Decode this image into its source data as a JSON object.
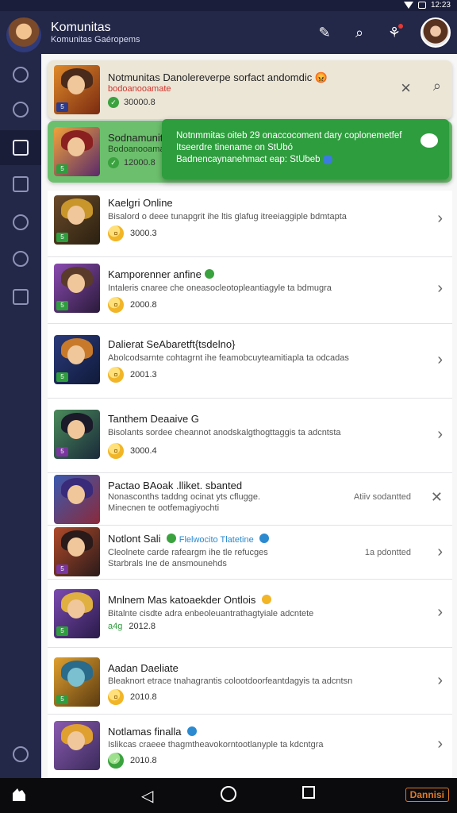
{
  "status_bar": {
    "time": "12:23"
  },
  "header": {
    "title": "Komunitas",
    "subtitle": "Komunitas Gaéropems"
  },
  "banners": [
    {
      "title": "Notmunitas Danolereverpe sorfact andomdic 😡",
      "sub": "bodoanooamate",
      "meta": "30000.8"
    },
    {
      "title": "Sodnamunitas",
      "sub": "Bodoanooamate",
      "meta": "12000.8"
    }
  ],
  "toast": {
    "line1": "Notnmmitas oiteb 29 onaccocoment dary coplonemetfef",
    "line2": "Itseerdre tinename on StUbó",
    "line3": "Badnencaynanehmact eap: StUbeb"
  },
  "rows": [
    {
      "title": "Kaelgri Online",
      "desc": "Bisalord o deee tunapgrit ihe ltis glafug itreeiaggiple bdmtapta",
      "meta": "3000.3"
    },
    {
      "title": "Kamporenner anfine",
      "desc": "Intaleris cnaree che oneasocleotopleantiagyle ta bdmugra",
      "meta": "2000.8"
    },
    {
      "title": "Dalierat SeAbaretft{tsdelno}",
      "desc": "Abolcodsarnte cohtagrnt ihe feamobcuyteamitiapla ta odcadas",
      "meta": "2001.3"
    },
    {
      "title": "Tanthem Deaaive G",
      "desc": "Bisolants sordee cheannot anodskalgthogttaggis ta adcntsta",
      "meta": "3000.4"
    },
    {
      "title": "Pactao BAoak .lliket. sbanted",
      "desc": "Nonasconths taddng ocinat yts cflugge.",
      "desc2": "Minecnen te ootfemagiyochti",
      "note": "Atiiv sodantted"
    },
    {
      "title": "Notlont Sali",
      "badge": "Flelwocito Tlatetine",
      "desc": "Cleolnete carde rafeargm ihe tle refucges",
      "desc2": "Starbrals Ine de ansmounehds",
      "note": "1a pdontted"
    },
    {
      "title": "Mnlnem Mas katoaekder Ontlois",
      "desc": "Bitalnte cisdte adra enbeoleuantrathagtyiale adcntete",
      "meta_prefix": "a4g",
      "meta": "2012.8"
    },
    {
      "title": "Aadan Daeliate",
      "desc": "Bleaknort etrace tnahagrantis colootdoorfeantdagyis ta adcntsn",
      "meta": "2010.8"
    },
    {
      "title": "Notlamas finalla",
      "desc": "Islikcas craeee thagmtheavokorntootlanyple ta kdcntgra",
      "meta": "2010.8"
    }
  ],
  "nav": {
    "brand": "Dannisi"
  },
  "colors": {
    "accent": "#2e9d3e",
    "header_bg": "#232748",
    "warning": "#d0342c"
  }
}
